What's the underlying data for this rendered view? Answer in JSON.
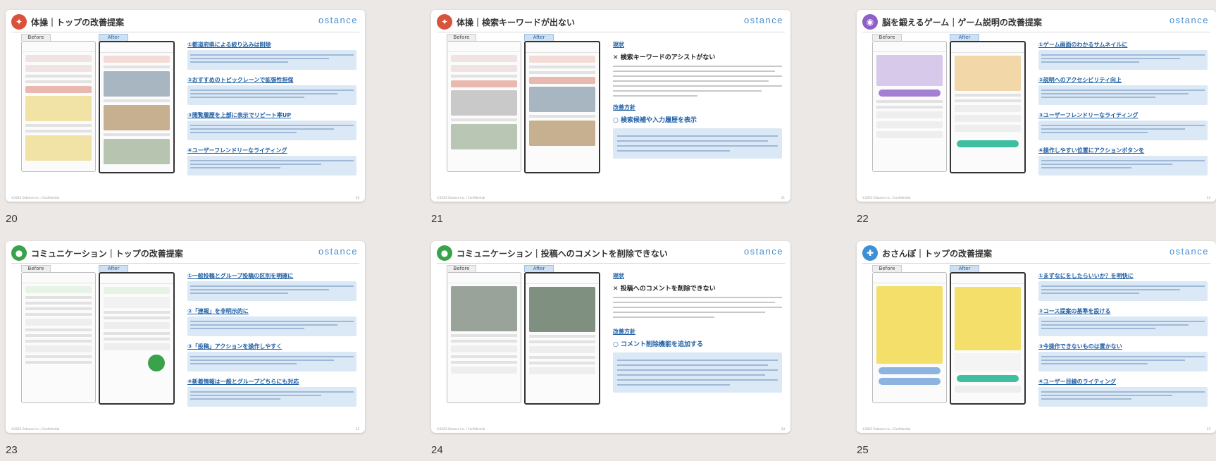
{
  "brand": "ostance",
  "footer_text": "©2023 Ostance inc. / Confidential",
  "colors": {
    "tab_after": "#cfe0f3",
    "accent_blue": "#1f5fa5",
    "exercise": "#d9533c",
    "brain": "#8e5fc8",
    "community": "#3aa24a",
    "walk": "#3d8fd6",
    "walk_map": "#f3df6a"
  },
  "labels": {
    "before": "Before",
    "after": "After",
    "status": "現状",
    "policy": "改善方針"
  },
  "slides": [
    {
      "number": "20",
      "title": "体操｜トップの改善提案",
      "icon": "person-exercise-icon",
      "points": [
        "①都道府県による絞り込みは削除",
        "②おすすめのトピックレーンで拡張性担保",
        "③閲覧履歴を上部に表示でリピート率UP",
        "④ユーザーフレンドリーなライティング"
      ]
    },
    {
      "number": "21",
      "title": "体操｜検索キーワードが出ない",
      "icon": "person-exercise-icon",
      "problem": "検索キーワードのアシストがない",
      "solution": "検索候補や入力履歴を表示"
    },
    {
      "number": "22",
      "title": "脳を鍛えるゲーム｜ゲーム説明の改善提案",
      "icon": "brain-icon",
      "points": [
        "①ゲーム画面のわかるサムネイルに",
        "②説明へのアクセシビリティ向上",
        "③ユーザーフレンドリーなライティング",
        "④操作しやすい位置にアクションボタンを"
      ]
    },
    {
      "number": "23",
      "title": "コミュニケーション｜トップの改善提案",
      "icon": "chat-bubble-icon",
      "points": [
        "①一般投稿とグループ投稿の区別を明確に",
        "②「連報」を非明示的に",
        "③「投稿」アクションを操作しやすく",
        "④新着情報は一般とグループどちらにも対応"
      ]
    },
    {
      "number": "24",
      "title": "コミュニケーション｜投稿へのコメントを削除できない",
      "icon": "chat-bubble-icon",
      "problem": "投稿へのコメントを削除できない",
      "solution": "コメント削除機能を追加する"
    },
    {
      "number": "25",
      "title": "おさんぽ｜トップの改善提案",
      "icon": "walking-person-icon",
      "points": [
        "①まずなにをしたらいいか？を明快に",
        "②コース提案の基準を設ける",
        "③今操作できないものは置かない",
        "④ユーザー目線のライティング"
      ]
    }
  ]
}
